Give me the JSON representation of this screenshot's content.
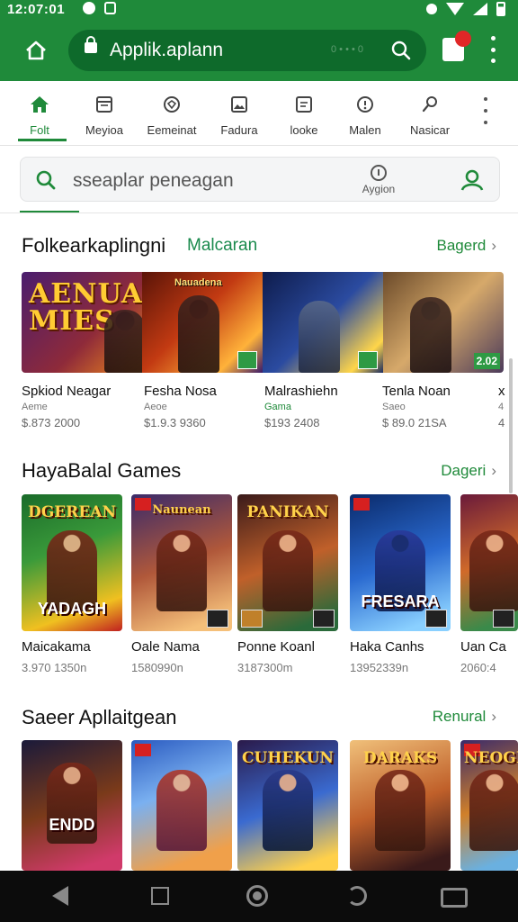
{
  "status": {
    "time": "12:07:01"
  },
  "browser": {
    "url": "Applik.aplann",
    "faint_text": "0 • • • 0",
    "tab_count": ""
  },
  "categories": [
    {
      "label": "Folt",
      "icon": "home-icon"
    },
    {
      "label": "Meyioa",
      "icon": "calendar-icon"
    },
    {
      "label": "Eemeinat",
      "icon": "tag-icon"
    },
    {
      "label": "Fadura",
      "icon": "image-icon"
    },
    {
      "label": "looke",
      "icon": "book-icon"
    },
    {
      "label": "Malen",
      "icon": "info-icon"
    },
    {
      "label": "Nasicar",
      "icon": "pin-icon"
    }
  ],
  "search": {
    "placeholder": "sseaplar peneagan",
    "action_label": "Aygion"
  },
  "section1": {
    "title": "Folkearkaplingni",
    "subtitle": "Malcaran",
    "more": "Bagerd",
    "banner_titles": [
      "AENUAN MIES",
      "Nauadena",
      "",
      ""
    ],
    "badge_text": "2.02",
    "apps": [
      {
        "name": "Spkiod Neagar",
        "sub": "Aeme",
        "price": "$.873 2000"
      },
      {
        "name": "Fesha Nosa",
        "sub": "Aeoe",
        "price": "$1.9.3 9360"
      },
      {
        "name": "Malrashiehn",
        "sub": "Gama",
        "price": "$193 2408"
      },
      {
        "name": "Tenla Noan",
        "sub": "Saeo",
        "price": "$ 89.0 21SA"
      },
      {
        "name": "x",
        "sub": "4",
        "price": "4"
      }
    ]
  },
  "section2": {
    "title": "HayaBalal Games",
    "more": "Dageri",
    "tiles": [
      {
        "top": "DGEREAN",
        "bottom": "YADAGH",
        "name": "Maicakama",
        "sub": "3.970 1350n"
      },
      {
        "top": "Naunean",
        "bottom": "",
        "name": "Oale Nama",
        "sub": "1580990n"
      },
      {
        "top": "PANIKAN",
        "bottom": "",
        "name": "Ponne Koanl",
        "sub": "3187300m"
      },
      {
        "top": "",
        "bottom": "FRESARA",
        "name": "Haka Canhs",
        "sub": "13952339n"
      },
      {
        "top": "",
        "bottom": "",
        "name": "Uan Ca",
        "sub": "2060:4"
      }
    ]
  },
  "section3": {
    "title": "Saeer Apllaitgean",
    "more": "Renural",
    "tiles": [
      {
        "top": "",
        "bottom": "ENDD"
      },
      {
        "top": "",
        "bottom": ""
      },
      {
        "top": "CUHEKUN",
        "bottom": ""
      },
      {
        "top": "DARAKS",
        "bottom": ""
      },
      {
        "top": "NEOGR",
        "bottom": ""
      }
    ]
  }
}
